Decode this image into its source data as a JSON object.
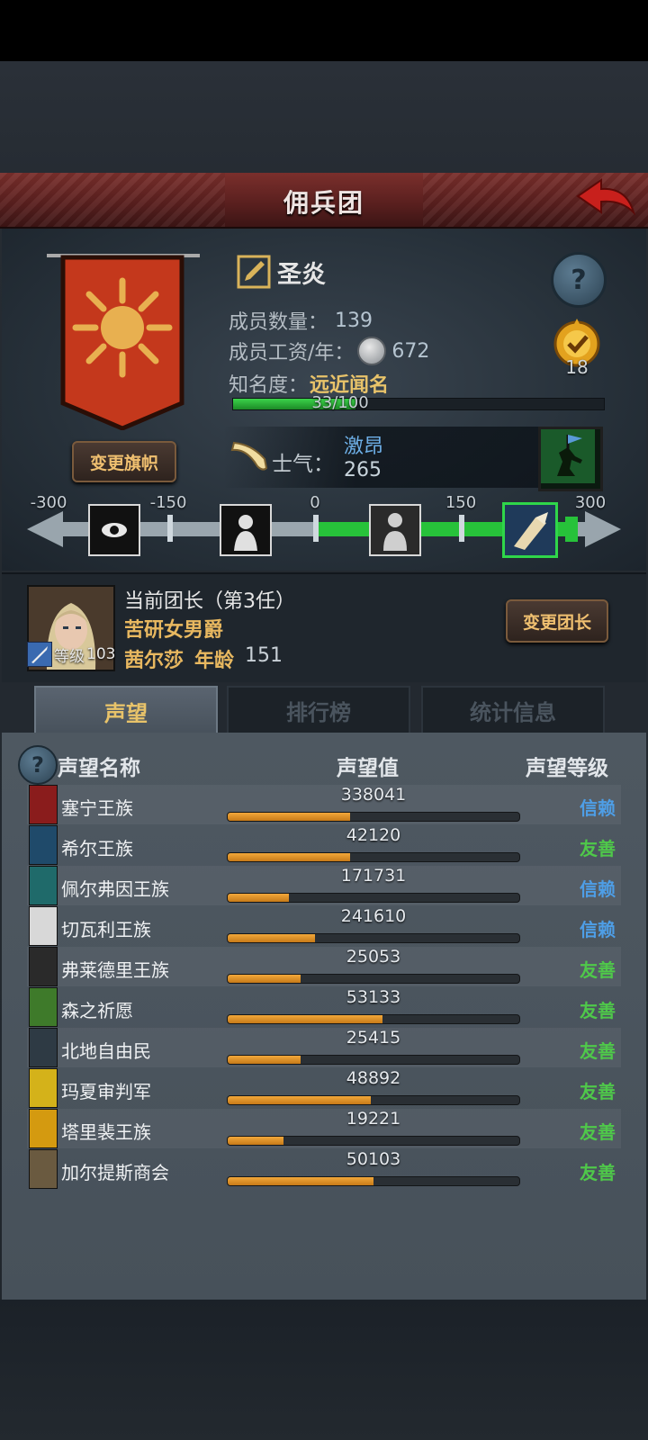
{
  "title": "佣兵团",
  "guild": {
    "name": "圣炎",
    "member_count_label": "成员数量：",
    "member_count": "139",
    "wage_label": "成员工资/年：",
    "wage": "672",
    "fame_label": "知名度：",
    "fame_value": "远近闻名",
    "fame_progress_text": "33/100",
    "fame_progress": 0.33,
    "medal_count": "18",
    "change_flag_label": "变更旗帜"
  },
  "morale": {
    "label": "士气：",
    "state": "激昂",
    "value": "265",
    "scale_labels": [
      "-300",
      "-150",
      "0",
      "150",
      "300"
    ]
  },
  "leader": {
    "title": "当前团长（第3任）",
    "trait": "苦研女男爵",
    "name": "茜尔莎",
    "age_label": "年龄",
    "age": "151",
    "level_label": "等级",
    "level": "103",
    "change_label": "变更团长"
  },
  "tabs": [
    "声望",
    "排行榜",
    "统计信息"
  ],
  "reputation": {
    "headers": [
      "声望名称",
      "声望值",
      "声望等级"
    ],
    "rows": [
      {
        "name": "塞宁王族",
        "value": "338041",
        "level": "信赖",
        "fill": 0.42,
        "icon_color": "#8a1c1c"
      },
      {
        "name": "希尔王族",
        "value": "42120",
        "level": "友善",
        "fill": 0.42,
        "icon_color": "#1f4a6a"
      },
      {
        "name": "佩尔弗因王族",
        "value": "171731",
        "level": "信赖",
        "fill": 0.21,
        "icon_color": "#1f6a6a"
      },
      {
        "name": "切瓦利王族",
        "value": "241610",
        "level": "信赖",
        "fill": 0.3,
        "icon_color": "#d8d8d8"
      },
      {
        "name": "弗莱德里王族",
        "value": "25053",
        "level": "友善",
        "fill": 0.25,
        "icon_color": "#2a2a2a"
      },
      {
        "name": "森之祈愿",
        "value": "53133",
        "level": "友善",
        "fill": 0.53,
        "icon_color": "#3e7a2a"
      },
      {
        "name": "北地自由民",
        "value": "25415",
        "level": "友善",
        "fill": 0.25,
        "icon_color": "#2e3a44"
      },
      {
        "name": "玛夏审判军",
        "value": "48892",
        "level": "友善",
        "fill": 0.49,
        "icon_color": "#d4b21a"
      },
      {
        "name": "塔里裴王族",
        "value": "19221",
        "level": "友善",
        "fill": 0.19,
        "icon_color": "#d49a10"
      },
      {
        "name": "加尔提斯商会",
        "value": "50103",
        "level": "友善",
        "fill": 0.5,
        "icon_color": "#6a5a40"
      }
    ]
  }
}
